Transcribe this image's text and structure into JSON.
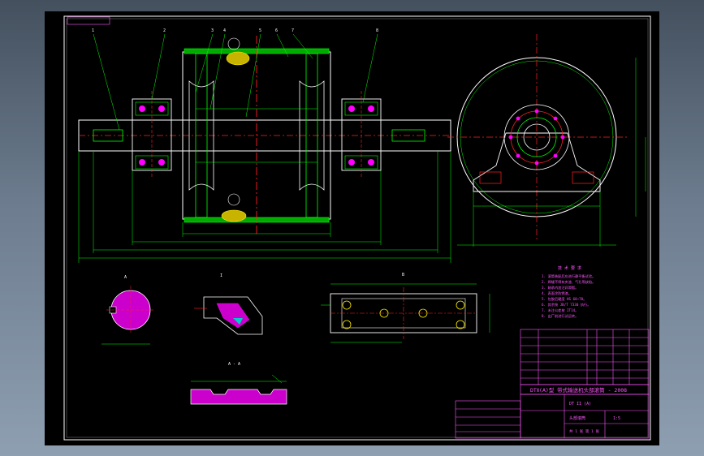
{
  "drawing": {
    "background_color": "#000000",
    "line_colors": {
      "outline": "#ffffff",
      "detail": "#00ff00",
      "centerline": "#ff2020",
      "section_fill": "#ff00ff",
      "rubber": "#ffee00",
      "text": "#ff55ff"
    },
    "main_title": "DTⅡ(A)型 带式输送机头部滚筒 - 2008",
    "section_labels": {
      "view_a": "A",
      "view_section": "1 : 1",
      "detail_1": "I",
      "detail_2": "Ⅱ",
      "bottom_detail": "A - A",
      "bearing_plan": "B"
    },
    "part_numbers": [
      "1",
      "2",
      "3",
      "4",
      "5",
      "6",
      "7",
      "8"
    ],
    "notes_title": "技 术 要 求",
    "notes": [
      "1. 滚筒装配后应进行静平衡试验。",
      "2. 焊缝不得有夹渣、气孔等缺陷。",
      "3. 轴承内加注润滑脂。",
      "4. 表面涂防锈漆。",
      "5. 包胶后硬度 HS 60~70。",
      "6. 其余按 JB/T 7330 执行。",
      "7. 未注公差按 IT14。",
      "8. 出厂前进行试运转。"
    ],
    "title_block": {
      "drawing_no": "DT II (A)",
      "scale": "1:5",
      "sheet": "共 1 张 第 1 张",
      "name": "头部滚筒"
    }
  }
}
